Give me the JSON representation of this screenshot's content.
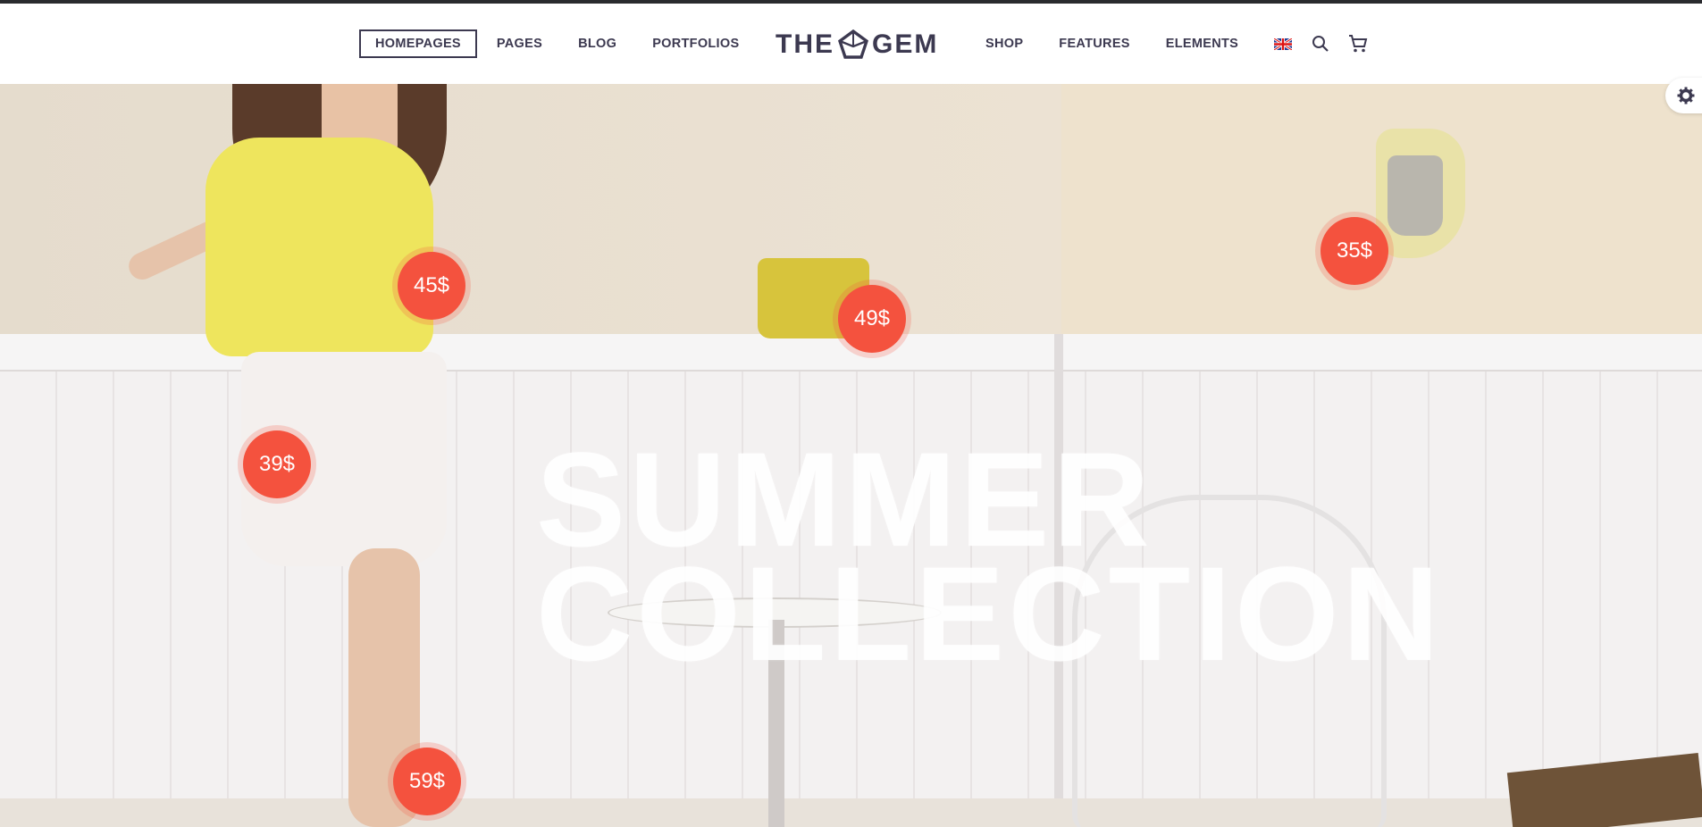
{
  "header": {
    "nav_left": [
      {
        "label": "HOMEPAGES",
        "active": true
      },
      {
        "label": "PAGES",
        "active": false
      },
      {
        "label": "BLOG",
        "active": false
      },
      {
        "label": "PORTFOLIOS",
        "active": false
      }
    ],
    "logo": {
      "left": "THE",
      "right": "GEM"
    },
    "nav_right": [
      {
        "label": "SHOP"
      },
      {
        "label": "FEATURES"
      },
      {
        "label": "ELEMENTS"
      }
    ],
    "icons": [
      "uk-flag-icon",
      "search-icon",
      "cart-icon"
    ]
  },
  "hero": {
    "title_line_1": "SUMMER",
    "title_line_2": "COLLECTION",
    "prices": [
      "45$",
      "49$",
      "35$",
      "39$",
      "59$"
    ]
  },
  "colors": {
    "accent": "#f4523e",
    "nav_text": "#3c3950",
    "top_bar": "#2a2b2f",
    "top_yellow": "#eee55d"
  },
  "settings_icon": "gear-icon"
}
